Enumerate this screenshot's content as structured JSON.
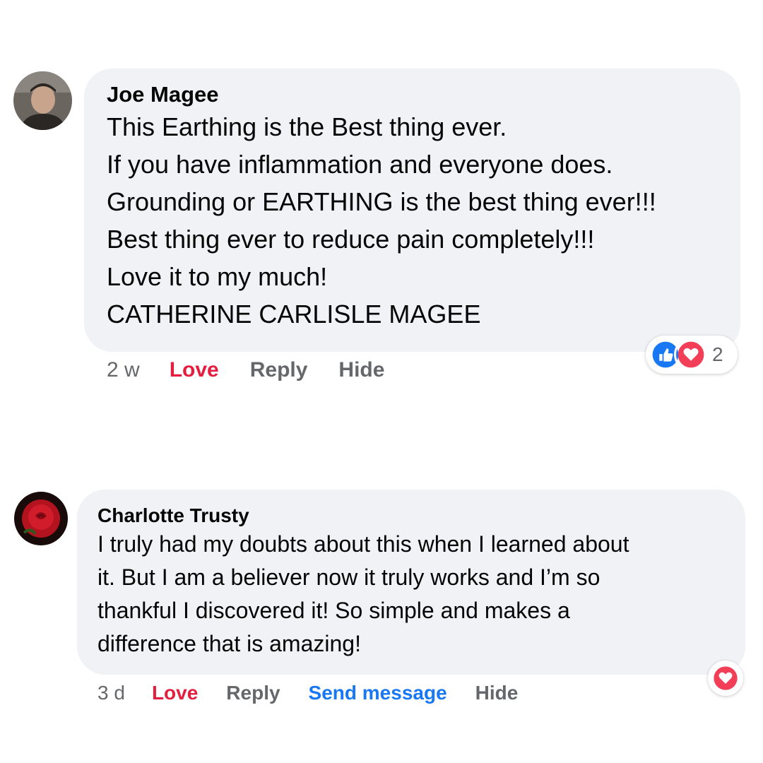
{
  "comments": [
    {
      "author": "Joe Magee",
      "lines": [
        "This Earthing is the Best thing ever.",
        "If you have inflammation and everyone does.",
        "Grounding or EARTHING is the best thing ever!!!",
        "Best thing ever to reduce pain completely!!!",
        "Love it to my much!",
        "CATHERINE CARLISLE MAGEE"
      ],
      "time": "2 w",
      "love_label": "Love",
      "reply_label": "Reply",
      "hide_label": "Hide",
      "reaction_icons": [
        "like-icon",
        "heart-icon"
      ],
      "reaction_count": "2"
    },
    {
      "author": "Charlotte Trusty",
      "lines": [
        "I truly had my doubts about this when I learned about",
        "it. But I am a believer now it truly works and I’m so",
        "thankful I discovered it! So simple and makes a",
        "difference that is amazing!"
      ],
      "time": "3 d",
      "love_label": "Love",
      "reply_label": "Reply",
      "send_label": "Send message",
      "hide_label": "Hide",
      "reaction_icons": [
        "heart-icon"
      ]
    }
  ],
  "colors": {
    "bubble": "#f0f2f5",
    "love": "#e41e3f",
    "link": "#1877f2",
    "muted": "#65676b",
    "like_blue": "#1877f2",
    "heart_red": "#f33e58"
  }
}
